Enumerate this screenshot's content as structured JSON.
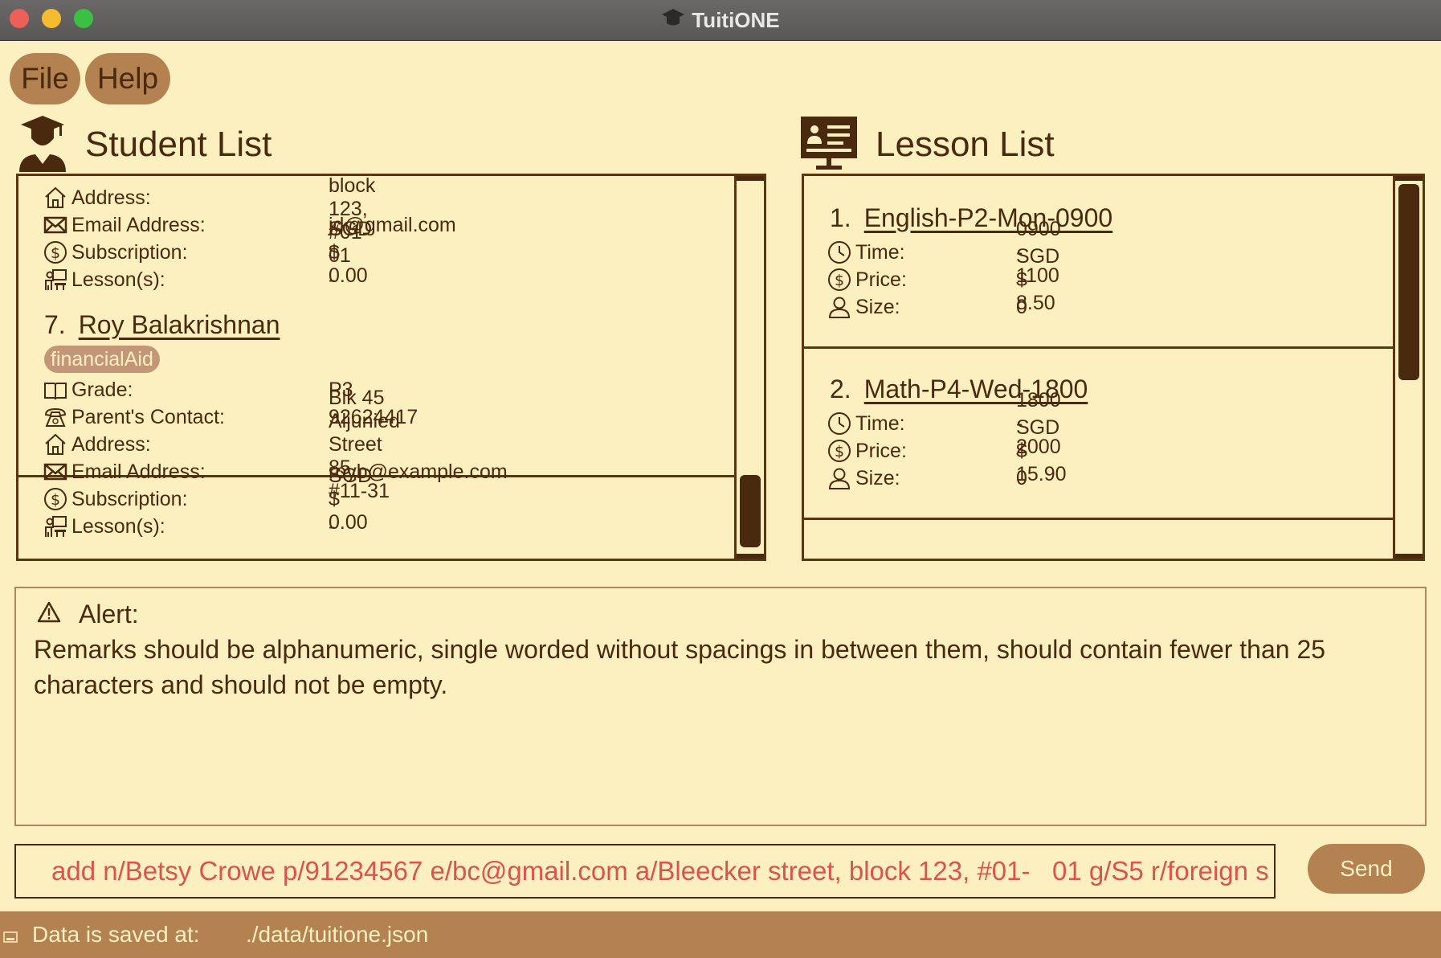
{
  "window": {
    "title": "TuitiONE"
  },
  "menu": {
    "file": "File",
    "help": "Help"
  },
  "student_list": {
    "title": "Student List",
    "partial_card": {
      "fields": [
        {
          "icon": "house-icon",
          "label": "Address:",
          "value": "John street, block 123, #01-01"
        },
        {
          "icon": "envelope-icon",
          "label": "Email Address:",
          "value": "jd@gmail.com"
        },
        {
          "icon": "dollar-icon",
          "label": "Subscription:",
          "value": "SGD $ 0.00"
        },
        {
          "icon": "lesson-icon",
          "label": "Lesson(s):",
          "value": "-"
        }
      ]
    },
    "card": {
      "index": "7.",
      "name": "Roy Balakrishnan",
      "tag": "financialAid",
      "fields": [
        {
          "icon": "book-icon",
          "label": "Grade:",
          "value": "P3"
        },
        {
          "icon": "phone-icon",
          "label": "Parent's Contact:",
          "value": "92624417"
        },
        {
          "icon": "house-icon",
          "label": "Address:",
          "value": "Blk 45 Aljunied Street 85, #11-31"
        },
        {
          "icon": "envelope-icon",
          "label": "Email Address:",
          "value": "royb@example.com"
        },
        {
          "icon": "dollar-icon",
          "label": "Subscription:",
          "value": "SGD $ 0.00"
        },
        {
          "icon": "lesson-icon",
          "label": "Lesson(s):",
          "value": "-"
        }
      ]
    }
  },
  "lesson_list": {
    "title": "Lesson List",
    "lessons": [
      {
        "index": "1.",
        "name": "English-P2-Mon-0900",
        "fields": [
          {
            "icon": "clock-icon",
            "label": "Time:",
            "value": "0900 - 1100"
          },
          {
            "icon": "dollar-icon",
            "label": "Price:",
            "value": "SGD $ 8.50"
          },
          {
            "icon": "person-icon",
            "label": "Size:",
            "value": "0"
          }
        ]
      },
      {
        "index": "2.",
        "name": "Math-P4-Wed-1800",
        "fields": [
          {
            "icon": "clock-icon",
            "label": "Time:",
            "value": "1800 - 2000"
          },
          {
            "icon": "dollar-icon",
            "label": "Price:",
            "value": "SGD $ 15.90"
          },
          {
            "icon": "person-icon",
            "label": "Size:",
            "value": "0"
          }
        ]
      }
    ]
  },
  "alert": {
    "label": "Alert:",
    "message": "Remarks should be alphanumeric, single worded without spacings in between them, should contain fewer than 25 characters and should not be empty."
  },
  "command": {
    "value": "add n/Betsy Crowe p/91234567 e/bc@gmail.com a/Bleecker street, block 123, #01-   01 g/S5 r/foreign s",
    "send_label": "Send"
  },
  "status": {
    "label": "Data is saved at:",
    "path": "./data/tuitione.json"
  },
  "colors": {
    "background": "#fdf0c0",
    "accent": "#b38250",
    "text": "#4a2a0e",
    "error": "#d9534f"
  }
}
